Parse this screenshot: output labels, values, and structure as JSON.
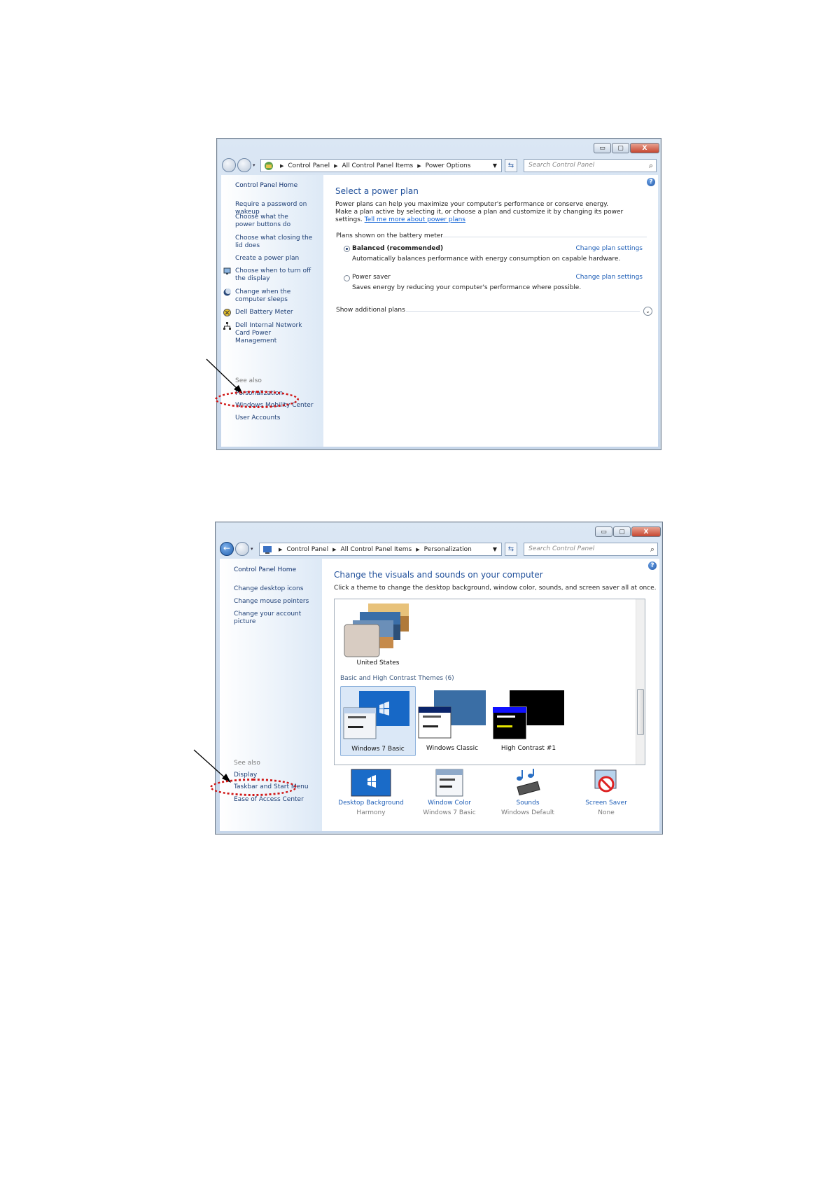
{
  "window1": {
    "caption_buttons": [
      "▭",
      "▢",
      "X"
    ],
    "address": {
      "crumbs": [
        "Control Panel",
        "All Control Panel Items",
        "Power Options"
      ]
    },
    "search_placeholder": "Search Control Panel",
    "sidebar": {
      "home": "Control Panel Home",
      "links": [
        "Require a password on wakeup",
        "Choose what the power buttons do",
        "Choose what closing the lid does",
        "Create a power plan",
        "Choose when to turn off the display",
        "Change when the computer sleeps",
        "Dell Battery Meter",
        "Dell Internal Network Card Power Management"
      ],
      "see_also_label": "See also",
      "see_also": [
        "Personalization",
        "Windows Mobility Center",
        "User Accounts"
      ]
    },
    "main": {
      "title": "Select a power plan",
      "intro": "Power plans can help you maximize your computer's performance or conserve energy. Make a plan active by selecting it, or choose a plan and customize it by changing its power settings.",
      "intro_link": "Tell me more about power plans",
      "plans_header": "Plans shown on the battery meter",
      "plans": [
        {
          "name": "Balanced (recommended)",
          "desc": "Automatically balances performance with energy consumption on capable hardware.",
          "selected": true,
          "action": "Change plan settings"
        },
        {
          "name": "Power saver",
          "desc": "Saves energy by reducing your computer's performance where possible.",
          "selected": false,
          "action": "Change plan settings"
        }
      ],
      "show_additional": "Show additional plans"
    }
  },
  "window2": {
    "caption_buttons": [
      "▭",
      "▢",
      "X"
    ],
    "address": {
      "crumbs": [
        "Control Panel",
        "All Control Panel Items",
        "Personalization"
      ]
    },
    "search_placeholder": "Search Control Panel",
    "sidebar": {
      "home": "Control Panel Home",
      "links": [
        "Change desktop icons",
        "Change mouse pointers",
        "Change your account picture"
      ],
      "see_also_label": "See also",
      "see_also": [
        "Display",
        "Taskbar and Start Menu",
        "Ease of Access Center"
      ]
    },
    "main": {
      "title": "Change the visuals and sounds on your computer",
      "intro": "Click a theme to change the desktop background, window color, sounds, and screen saver all at once.",
      "my_theme": "United States",
      "group_caption": "Basic and High Contrast Themes (6)",
      "themes": [
        "Windows 7 Basic",
        "Windows Classic",
        "High Contrast #1"
      ],
      "bottom": [
        {
          "label": "Desktop Background",
          "sub": "Harmony"
        },
        {
          "label": "Window Color",
          "sub": "Windows 7 Basic"
        },
        {
          "label": "Sounds",
          "sub": "Windows Default"
        },
        {
          "label": "Screen Saver",
          "sub": "None"
        }
      ]
    }
  },
  "colors": {
    "accent": "#1f5fb7",
    "annotation": "#d01616",
    "link": "#0b5fd6"
  }
}
